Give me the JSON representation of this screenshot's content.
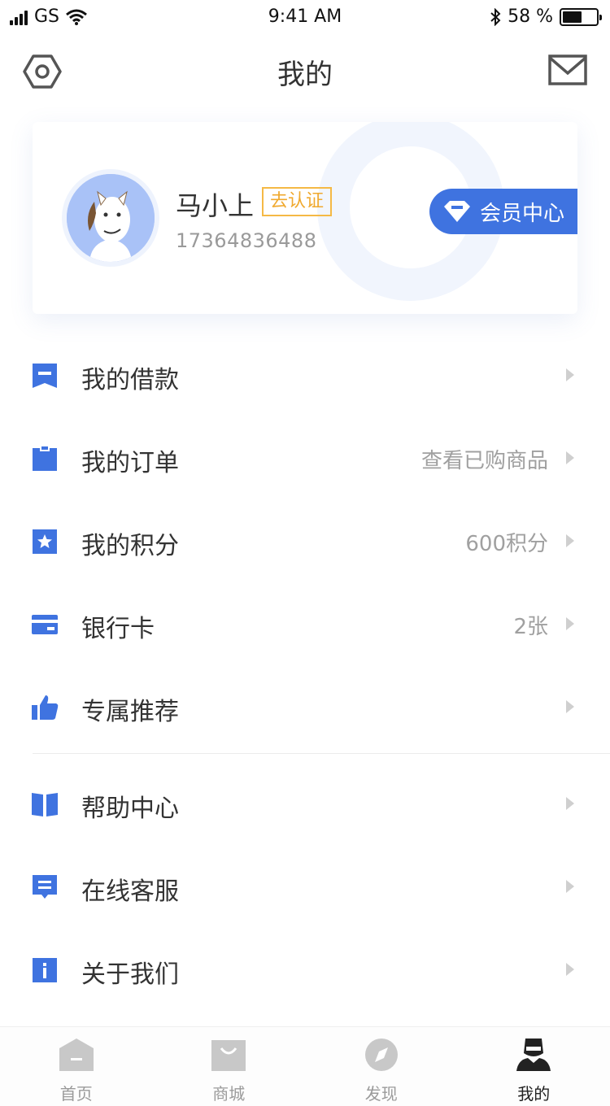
{
  "status_bar": {
    "carrier": "GS",
    "time": "9:41 AM",
    "battery_percent": "58 %",
    "battery_level": 0.58
  },
  "nav": {
    "title": "我的",
    "left_icon": "settings-hexagon-icon",
    "right_icon": "mail-icon"
  },
  "profile": {
    "name": "马小上",
    "verify_label": "去认证",
    "phone": "17364836488",
    "member_label": "会员中心",
    "accent_color": "#3f73e0",
    "verify_color": "#f0a92e"
  },
  "menu": {
    "group1": [
      {
        "label": "我的借款",
        "extra": "",
        "icon": "loan-bookmark-icon"
      },
      {
        "label": "我的订单",
        "extra": "查看已购商品",
        "icon": "order-clipboard-icon"
      },
      {
        "label": "我的积分",
        "extra": "600积分",
        "icon": "points-star-icon"
      },
      {
        "label": "银行卡",
        "extra": "2张",
        "icon": "bank-card-icon"
      },
      {
        "label": "专属推荐",
        "extra": "",
        "icon": "thumbs-up-icon"
      }
    ],
    "group2": [
      {
        "label": "帮助中心",
        "extra": "",
        "icon": "help-book-icon"
      },
      {
        "label": "在线客服",
        "extra": "",
        "icon": "chat-service-icon"
      },
      {
        "label": "关于我们",
        "extra": "",
        "icon": "info-icon"
      }
    ]
  },
  "tabs": [
    {
      "label": "首页",
      "icon": "home-icon",
      "active": false
    },
    {
      "label": "商城",
      "icon": "shop-bag-icon",
      "active": false
    },
    {
      "label": "发现",
      "icon": "compass-icon",
      "active": false
    },
    {
      "label": "我的",
      "icon": "profile-icon",
      "active": true
    }
  ]
}
